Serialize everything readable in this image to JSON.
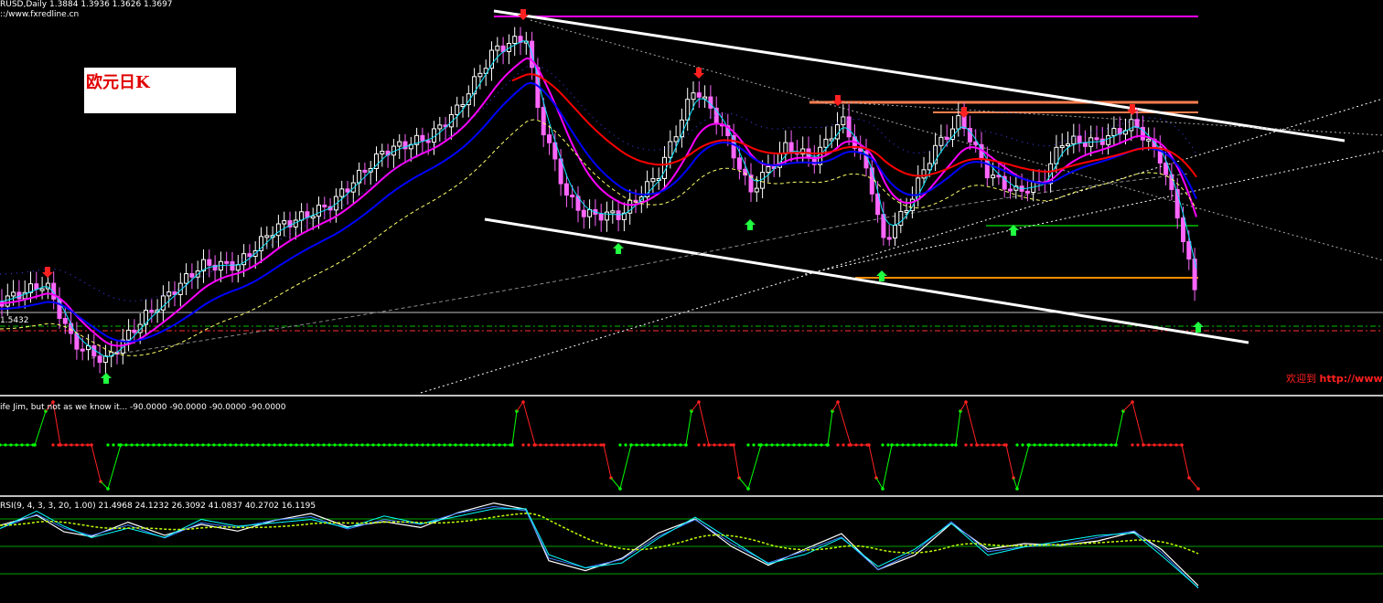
{
  "main": {
    "header_line1": "RUSD,Daily  1.3884 1.3936 1.3626 1.3697",
    "header_line2": "::/www.fxredline.cn",
    "legend_title": "欧元日K",
    "price_tag": "1.5432",
    "welcome_prefix": "欢迎到",
    "welcome_link": "http://www.fx",
    "colors": {
      "bull": "#ffffff",
      "bear": "#ff66ff",
      "ema_fast": "#00e5ff",
      "ema_mid": "#0000ff",
      "ema_slow": "#ff00ff",
      "ema_red": "#ff0000",
      "channel": "#ffffff"
    }
  },
  "jim": {
    "header": "ife Jim, but not as we know it...  -90.0000 -90.0000 -90.0000 -90.0000"
  },
  "rsi": {
    "header": "RSI(9, 4, 3, 3, 20, 1.00) 21.4968 24.1232 26.3092 41.0837 40.2702 16.1195"
  },
  "icons": [
    "down-arrow-icon",
    "up-arrow-icon"
  ]
}
